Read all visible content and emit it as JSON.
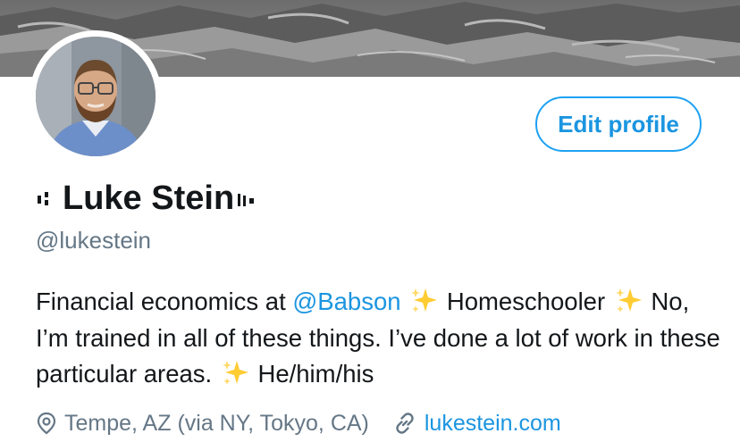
{
  "header": {
    "banner_icon": "landscape-photo",
    "avatar_icon": "profile-photo"
  },
  "actions": {
    "edit_profile_label": "Edit profile"
  },
  "profile": {
    "display_name": "Luke Stein",
    "handle": "@lukestein",
    "bio": {
      "part1": "Financial economics at ",
      "mention": "@Babson",
      "part2": "Homeschooler",
      "part3": "No, I’m trained in all of these things. I’ve done a lot of work in these particular areas.",
      "part4": "He/him/his",
      "sparkle_icon": "sparkles-emoji"
    },
    "location": "Tempe, AZ (via NY, Tokyo, CA)",
    "location_icon": "location-pin-icon",
    "website": "lukestein.com",
    "website_icon": "link-icon"
  },
  "colors": {
    "accent": "#1b95e0",
    "secondary_text": "#657786",
    "primary_text": "#14171a"
  }
}
